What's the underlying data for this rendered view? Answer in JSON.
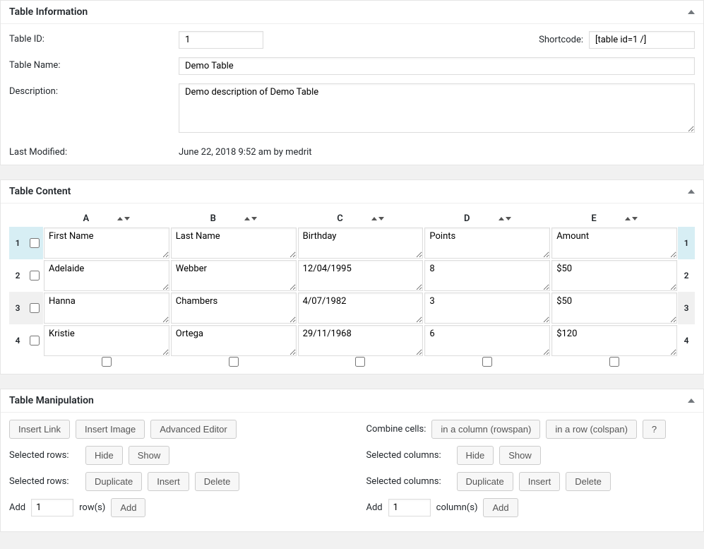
{
  "info_panel": {
    "title": "Table Information",
    "id_label": "Table ID:",
    "id_value": "1",
    "shortcode_label": "Shortcode:",
    "shortcode_value": "[table id=1 /]",
    "name_label": "Table Name:",
    "name_value": "Demo Table",
    "desc_label": "Description:",
    "desc_value": "Demo description of Demo Table",
    "modified_label": "Last Modified:",
    "modified_value": "June 22, 2018 9:52 am by medrit"
  },
  "content_panel": {
    "title": "Table Content",
    "columns": [
      "A",
      "B",
      "C",
      "D",
      "E"
    ],
    "rows": [
      {
        "n": "1",
        "cells": [
          "First Name",
          "Last Name",
          "Birthday",
          "Points",
          "Amount"
        ]
      },
      {
        "n": "2",
        "cells": [
          "Adelaide",
          "Webber",
          "12/04/1995",
          "8",
          "$50"
        ]
      },
      {
        "n": "3",
        "cells": [
          "Hanna",
          "Chambers",
          "4/07/1982",
          "3",
          "$50"
        ]
      },
      {
        "n": "4",
        "cells": [
          "Kristie",
          "Ortega",
          "29/11/1968",
          "6",
          "$120"
        ]
      }
    ]
  },
  "manip_panel": {
    "title": "Table Manipulation",
    "buttons": {
      "insert_link": "Insert Link",
      "insert_image": "Insert Image",
      "advanced_editor": "Advanced Editor",
      "rowspan": "in a column (rowspan)",
      "colspan": "in a row (colspan)",
      "help": "?",
      "hide": "Hide",
      "show": "Show",
      "duplicate": "Duplicate",
      "insert": "Insert",
      "delete": "Delete",
      "add": "Add"
    },
    "labels": {
      "combine_cells": "Combine cells:",
      "selected_rows": "Selected rows:",
      "selected_columns": "Selected columns:",
      "add_prefix": "Add",
      "rows_suffix": "row(s)",
      "cols_suffix": "column(s)"
    },
    "values": {
      "add_rows": "1",
      "add_cols": "1"
    }
  }
}
